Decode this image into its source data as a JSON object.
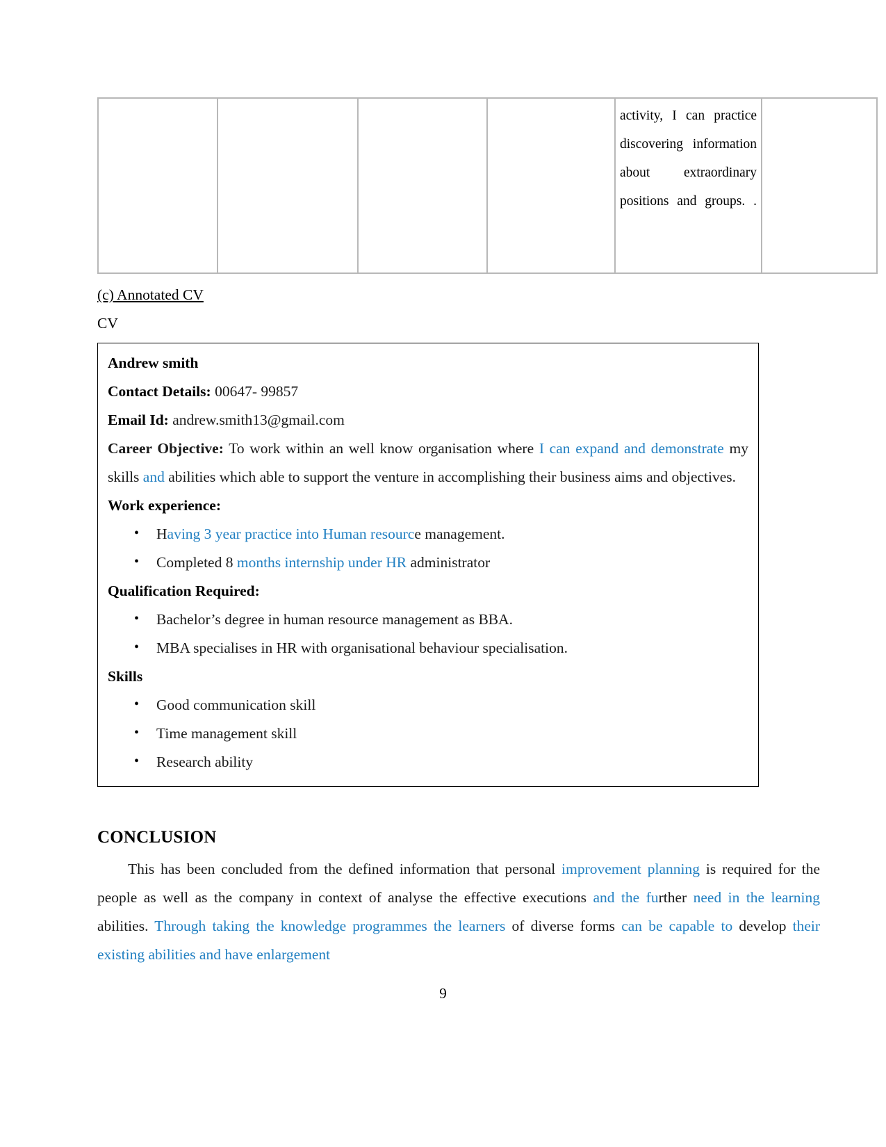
{
  "document": {
    "page_number": "9",
    "accent_color": "#2280c2",
    "text_color": "#1a1a1a"
  },
  "continuation_table": {
    "columns": 6,
    "cells": [
      "",
      "",
      "",
      "",
      "activity, I can practice discovering information about extraordinary positions and groups. .",
      ""
    ]
  },
  "section_label": "(c) Annotated CV",
  "cv_caption": "CV",
  "cv": {
    "name": "Andrew smith",
    "contact_label": "Contact Details:",
    "contact_value": " 00647- 99857",
    "email_label": "Email Id:",
    "email_value": " andrew.smith13@gmail.com",
    "objective_label": "Career Objective:",
    "objective_part1": "  To work within an well know organisation where ",
    "objective_blue1": "I can expand and demonstrate",
    "objective_part2": " my skills ",
    "objective_blue2": "and",
    "objective_part3": " abilities which able to support the venture in accomplishing their business aims and objectives.",
    "work_label": "Work experience:",
    "work_items": [
      {
        "pre": "H",
        "blue": "aving 3 year practice into Human resourc",
        "post": "e management."
      },
      {
        "pre": "Completed 8 ",
        "blue": "months internship under HR",
        "post": " administrator"
      }
    ],
    "qualification_label": "Qualification Required:",
    "qualification_items": [
      "Bachelor’s degree in human resource management as BBA.",
      "MBA specialises in HR with organisational behaviour specialisation."
    ],
    "skills_label": "Skills",
    "skills_items": [
      "Good communication skill",
      "Time management skill",
      "Research ability"
    ]
  },
  "conclusion": {
    "title": "CONCLUSION",
    "p1_black1": "This has been concluded from the defined information that personal ",
    "p1_blue1": "improvement planning",
    "p1_black2": " is required for the people as well as the company in context of analyse the effective executions ",
    "p1_blue2": "and the fu",
    "p1_black3": "rther",
    "p1_blue3": " need ",
    "p1_black4": "",
    "p1_blue4": "in the learning",
    "p1_black5": " abilities. ",
    "p1_blue5": "Through taking the knowledge programmes the learners",
    "p1_black6": " of diverse forms ",
    "p1_blue6": "can be capable to",
    "p1_black7": " develop ",
    "p1_blue7": "their existing abilities and have enlargement"
  }
}
